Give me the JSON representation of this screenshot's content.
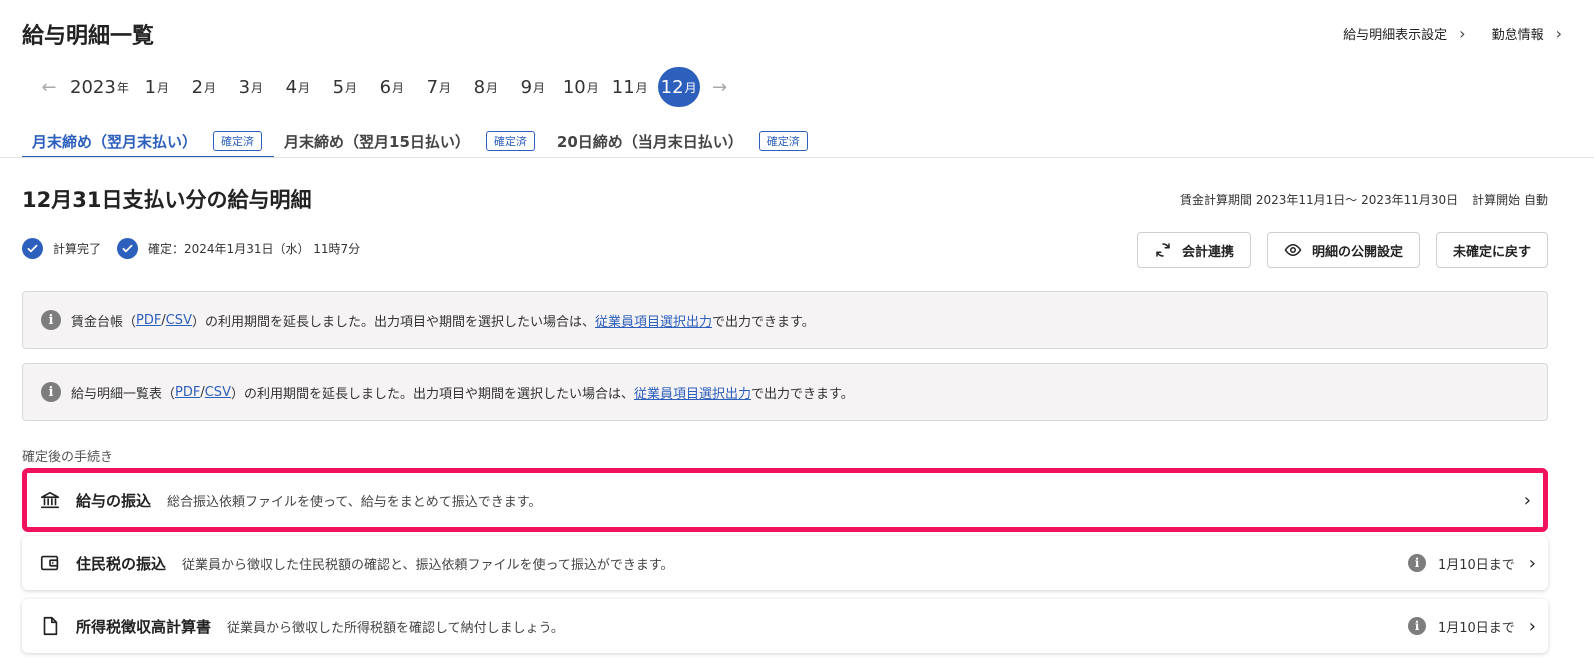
{
  "header": {
    "title": "給与明細一覧",
    "links": [
      {
        "label": "給与明細表示設定"
      },
      {
        "label": "勤怠情報"
      }
    ]
  },
  "month_nav": {
    "year": "2023",
    "year_unit": "年",
    "month_unit": "月",
    "months": [
      "1",
      "2",
      "3",
      "4",
      "5",
      "6",
      "7",
      "8",
      "9",
      "10",
      "11",
      "12"
    ],
    "selected": "12"
  },
  "tabs": [
    {
      "label": "月末締め（翌月末払い）",
      "badge": "確定済",
      "active": true
    },
    {
      "label": "月末締め（翌月15日払い）",
      "badge": "確定済",
      "active": false
    },
    {
      "label": "20日締め（当月末日払い）",
      "badge": "確定済",
      "active": false
    }
  ],
  "section": {
    "title": "12月31日支払い分の給与明細",
    "period": "賃金計算期間 2023年11月1日～ 2023年11月30日",
    "calc_start": "計算開始 自動"
  },
  "status": {
    "calc_done": "計算完了",
    "confirmed": "確定：2024年1月31日（水） 11時7分"
  },
  "actions": {
    "accounting": "会計連携",
    "publish": "明細の公開設定",
    "revert": "未確定に戻す"
  },
  "notices": [
    {
      "pre": "賃金台帳（",
      "pdf": "PDF",
      "sep": "/",
      "csv": "CSV",
      "mid": "）の利用期間を延長しました。出力項目や期間を選択したい場合は、",
      "link": "従業員項目選択出力",
      "post": "で出力できます。"
    },
    {
      "pre": "給与明細一覧表（",
      "pdf": "PDF",
      "sep": "/",
      "csv": "CSV",
      "mid": "）の利用期間を延長しました。出力項目や期間を選択したい場合は、",
      "link": "従業員項目選択出力",
      "post": "で出力できます。"
    }
  ],
  "procedures": {
    "heading": "確定後の手続き",
    "items": [
      {
        "icon": "bank-icon",
        "title": "給与の振込",
        "desc": "総合振込依頼ファイルを使って、給与をまとめて振込できます。",
        "due": ""
      },
      {
        "icon": "wallet-icon",
        "title": "住民税の振込",
        "desc": "従業員から徴収した住民税額の確認と、振込依頼ファイルを使って振込ができます。",
        "due": "1月10日まで"
      },
      {
        "icon": "document-icon",
        "title": "所得税徴収高計算書",
        "desc": "従業員から徴収した所得税額を確認して納付しましょう。",
        "due": "1月10日まで"
      }
    ]
  },
  "colors": {
    "accent": "#2d5fbd",
    "highlight": "#f0125c"
  }
}
